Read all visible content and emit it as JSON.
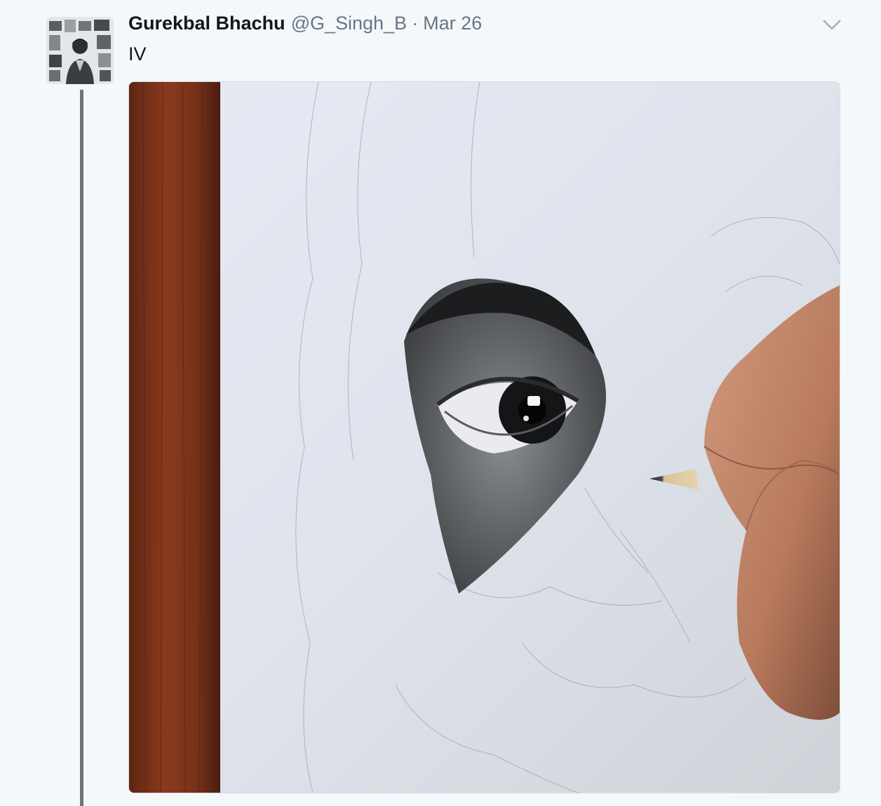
{
  "tweet": {
    "author": {
      "display_name": "Gurekbal Bhachu",
      "handle": "@G_Singh_B",
      "avatar_icon": "profile-photo"
    },
    "separator": "·",
    "timestamp": "Mar 26",
    "text": "IV",
    "menu_icon": "chevron-down-icon",
    "media": {
      "type": "photo",
      "alt_subject": "pencil drawing of an eye"
    }
  },
  "colors": {
    "name": "#14171a",
    "secondary": "#657786",
    "background": "#f5f8fa",
    "thread_line": "#6e7479"
  }
}
